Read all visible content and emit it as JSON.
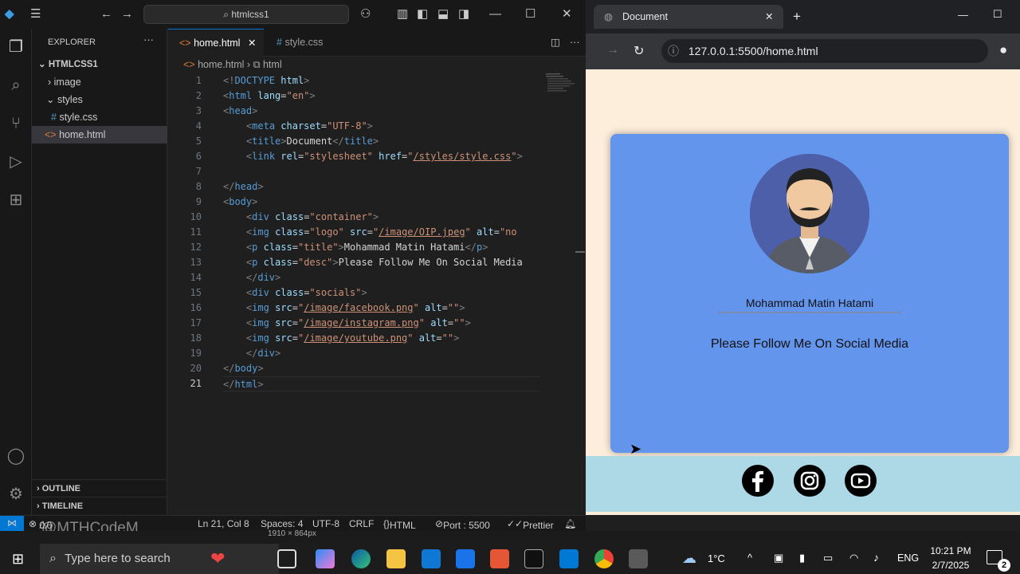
{
  "vscode": {
    "command_center": "htmlcss1",
    "explorer_title": "EXPLORER",
    "project": "HTMLCSS1",
    "tree": [
      "image",
      "styles",
      "style.css",
      "home.html"
    ],
    "tabs": [
      "home.html",
      "style.css"
    ],
    "breadcrumb": [
      "home.html",
      "html"
    ],
    "outline": "OUTLINE",
    "timeline": "TIMELINE",
    "status": {
      "position": "Ln 21, Col 8",
      "spaces": "Spaces: 4",
      "encoding": "UTF-8",
      "eol": "CRLF",
      "language": "HTML",
      "port": "Port : 5500",
      "prettier": "Prettier",
      "errors": "0",
      "warnings": "0",
      "watermark": "@MTHCodeM",
      "dims": "1910 × 864px"
    }
  },
  "browser": {
    "tab_title": "Document",
    "url": "127.0.0.1:5500/home.html",
    "profile_name": "Mohammad Matin Hatami",
    "desc": "Please Follow Me On Social Media"
  },
  "taskbar": {
    "search_placeholder": "Type here to search",
    "temp": "1°C",
    "lang": "ENG",
    "time": "10:21 PM",
    "date": "2/7/2025",
    "notif": "2"
  },
  "colors": {
    "accent": "#0078d4",
    "card": "#6495ed",
    "page": "#fdeedc",
    "socials": "#add8e6"
  }
}
